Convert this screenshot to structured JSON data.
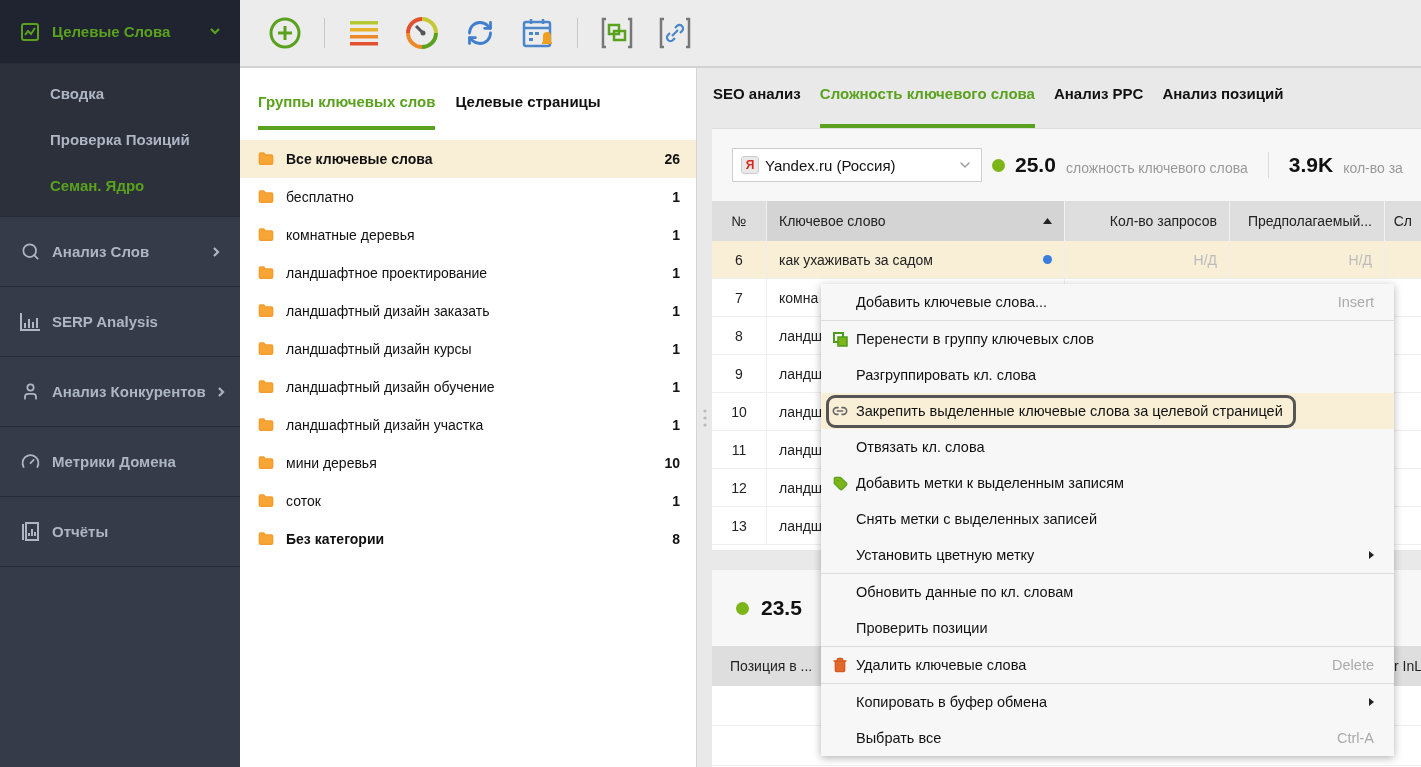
{
  "sidebar": {
    "sections": [
      {
        "label": "Целевые Слова",
        "kind": "keywords",
        "selected": true,
        "has_submenu": true,
        "expanded": true,
        "children": [
          {
            "label": "Сводка",
            "selected": false
          },
          {
            "label": "Проверка Позиций",
            "selected": false
          },
          {
            "label": "Семан. Ядро",
            "selected": true
          }
        ]
      },
      {
        "label": "Анализ Слов",
        "kind": "search",
        "selected": false,
        "has_submenu": true,
        "expanded": false
      },
      {
        "label": "SERP Analysis",
        "kind": "chart",
        "selected": false,
        "has_submenu": false
      },
      {
        "label": "Анализ Конкурентов",
        "kind": "person",
        "selected": false,
        "has_submenu": true,
        "expanded": false
      },
      {
        "label": "Метрики Домена",
        "kind": "gauge",
        "selected": false,
        "has_submenu": false
      },
      {
        "label": "Отчёты",
        "kind": "report",
        "selected": false,
        "has_submenu": false
      }
    ]
  },
  "left_panel": {
    "tabs": [
      {
        "label": "Группы ключевых слов",
        "selected": true
      },
      {
        "label": "Целевые страницы",
        "selected": false
      }
    ],
    "groups": [
      {
        "name": "Все ключевые слова",
        "count": "26",
        "bold": true,
        "selected": true
      },
      {
        "name": "бесплатно",
        "count": "1",
        "bold": false,
        "selected": false
      },
      {
        "name": "комнатные деревья",
        "count": "1",
        "bold": false,
        "selected": false
      },
      {
        "name": "ландшафтное проектирование",
        "count": "1",
        "bold": false,
        "selected": false
      },
      {
        "name": "ландшафтный дизайн заказать",
        "count": "1",
        "bold": false,
        "selected": false
      },
      {
        "name": "ландшафтный дизайн курсы",
        "count": "1",
        "bold": false,
        "selected": false
      },
      {
        "name": "ландшафтный дизайн обучение",
        "count": "1",
        "bold": false,
        "selected": false
      },
      {
        "name": "ландшафтный дизайн участка",
        "count": "1",
        "bold": false,
        "selected": false
      },
      {
        "name": "мини деревья",
        "count": "10",
        "bold": false,
        "selected": false
      },
      {
        "name": "соток",
        "count": "1",
        "bold": false,
        "selected": false
      },
      {
        "name": "Без категории",
        "count": "8",
        "bold": true,
        "selected": false
      }
    ]
  },
  "right_panel": {
    "tabs": [
      {
        "label": "SEO анализ",
        "selected": false
      },
      {
        "label": "Сложность ключевого слова",
        "selected": true
      },
      {
        "label": "Анализ PPC",
        "selected": false
      },
      {
        "label": "Анализ позиций",
        "selected": false
      }
    ],
    "search_engine": {
      "value": "Yandex.ru (Россия)",
      "logo": "Я"
    },
    "stats": [
      {
        "value": "25.0",
        "label": "сложность ключевого слова",
        "color": "#7cb518"
      },
      {
        "value": "3.9K",
        "label": "кол-во за"
      }
    ],
    "table": {
      "columns": [
        {
          "label": "№",
          "sorted": false
        },
        {
          "label": "Ключевое слово",
          "sorted": true
        },
        {
          "label": "Кол-во запросов",
          "sorted": false
        },
        {
          "label": "Предполагаемый...",
          "sorted": false
        },
        {
          "label": "Сл",
          "sorted": false
        }
      ],
      "rows": [
        {
          "number": "6",
          "keyword": "как ухаживать за садом",
          "color": "#3b7ddd",
          "column_3": "Н/Д",
          "column_4": "Н/Д",
          "selected": true
        },
        {
          "number": "7",
          "keyword": "комна",
          "selected": false
        },
        {
          "number": "8",
          "keyword": "ландш",
          "selected": false
        },
        {
          "number": "9",
          "keyword": "ландш",
          "selected": false
        },
        {
          "number": "10",
          "keyword": "ландш",
          "selected": false
        },
        {
          "number": "11",
          "keyword": "ландш",
          "selected": false
        },
        {
          "number": "12",
          "keyword": "ландш",
          "selected": false
        },
        {
          "number": "13",
          "keyword": "ландш",
          "selected": false
        }
      ]
    },
    "bottom": {
      "score": {
        "value": "23.5",
        "color": "#7cb518"
      },
      "columns": [
        {
          "label": "Позиция в ..."
        },
        {
          "label": "r InL"
        }
      ]
    }
  },
  "context_menu": {
    "groups": [
      [
        {
          "label": "Добавить ключевые слова...",
          "kind": "plain",
          "shortcut": "Insert",
          "submenu": false,
          "selected": false
        }
      ],
      [
        {
          "label": "Перенести в группу ключевых слов",
          "kind": "move",
          "submenu": false,
          "selected": false
        },
        {
          "label": "Разгруппировать кл. слова",
          "kind": "plain",
          "submenu": false,
          "selected": false
        },
        {
          "label": "Закрепить выделенные ключевые слова за целевой страницей",
          "kind": "link",
          "submenu": false,
          "selected": true
        },
        {
          "label": "Отвязать кл. слова",
          "kind": "plain",
          "submenu": false,
          "selected": false
        },
        {
          "label": "Добавить метки к выделенным записям",
          "kind": "tag",
          "submenu": false,
          "selected": false
        },
        {
          "label": "Снять метки с выделенных записей",
          "kind": "plain",
          "submenu": false,
          "selected": false
        },
        {
          "label": "Установить цветную метку",
          "kind": "plain",
          "submenu": true,
          "selected": false
        }
      ],
      [
        {
          "label": "Обновить данные по кл. словам",
          "kind": "plain",
          "submenu": false,
          "selected": false
        },
        {
          "label": "Проверить позиции",
          "kind": "plain",
          "submenu": false,
          "selected": false
        }
      ],
      [
        {
          "label": "Удалить ключевые слова",
          "kind": "delete",
          "shortcut": "Delete",
          "submenu": false,
          "selected": false
        }
      ],
      [
        {
          "label": "Копировать в буфер обмена",
          "kind": "plain",
          "submenu": true,
          "selected": false
        },
        {
          "label": "Выбрать все",
          "kind": "plain",
          "shortcut": "Ctrl-A",
          "submenu": false,
          "selected": false
        }
      ]
    ]
  }
}
